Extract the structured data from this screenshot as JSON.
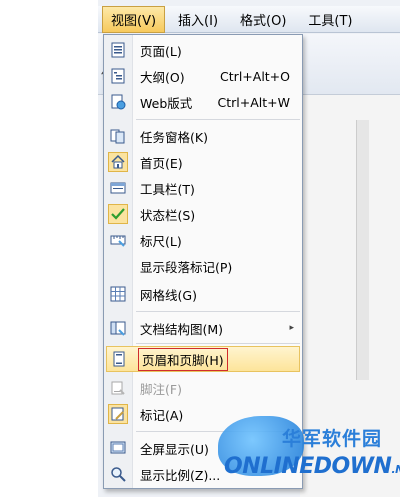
{
  "menubar": {
    "items": [
      {
        "label": "视图(V)",
        "active": true
      },
      {
        "label": "插入(I)"
      },
      {
        "label": "格式(O)"
      },
      {
        "label": "工具(T)"
      }
    ]
  },
  "background": {
    "side_text": "仿"
  },
  "dropdown": {
    "items": [
      {
        "label": "页面(L)",
        "shortcut": "",
        "icon": "page-view-icon"
      },
      {
        "label": "大纲(O)",
        "shortcut": "Ctrl+Alt+O",
        "icon": "outline-icon"
      },
      {
        "label": "Web版式",
        "shortcut": "Ctrl+Alt+W",
        "icon": "web-layout-icon"
      },
      {
        "label": "任务窗格(K)",
        "shortcut": "",
        "icon": "task-pane-icon"
      },
      {
        "label": "首页(E)",
        "shortcut": "",
        "icon": "home-icon"
      },
      {
        "label": "工具栏(T)",
        "shortcut": "",
        "icon": "toolbar-icon"
      },
      {
        "label": "状态栏(S)",
        "shortcut": "",
        "icon": "checkmark-icon"
      },
      {
        "label": "标尺(L)",
        "shortcut": "",
        "icon": "ruler-icon"
      },
      {
        "label": "显示段落标记(P)",
        "shortcut": "",
        "icon": ""
      },
      {
        "label": "网格线(G)",
        "shortcut": "",
        "icon": "grid-icon"
      },
      {
        "label": "文档结构图(M)",
        "shortcut": "",
        "icon": "document-map-icon"
      },
      {
        "label": "页眉和页脚(H)",
        "shortcut": "",
        "icon": "header-footer-icon"
      },
      {
        "label": "脚注(F)",
        "shortcut": "",
        "icon": "footnote-icon"
      },
      {
        "label": "标记(A)",
        "shortcut": "",
        "icon": "markup-icon"
      },
      {
        "label": "全屏显示(U)",
        "shortcut": "",
        "icon": "fullscreen-icon"
      },
      {
        "label": "显示比例(Z)...",
        "shortcut": "",
        "icon": "zoom-icon"
      }
    ]
  },
  "colors": {
    "highlight_border": "#d12c2c",
    "accent": "#f7c95c",
    "watermark_blue": "#2b7fd9"
  },
  "watermark": {
    "cn": "华军软件园",
    "en": "ONLINEDOWN",
    "suffix": ".NET"
  }
}
